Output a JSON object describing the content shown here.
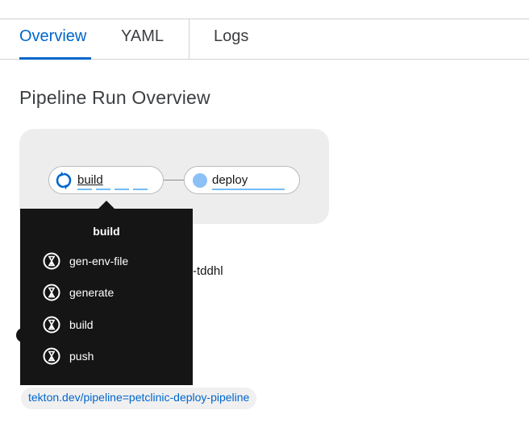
{
  "tabs": [
    {
      "label": "Overview",
      "active": true
    },
    {
      "label": "YAML",
      "active": false
    },
    {
      "label": "Logs",
      "active": false
    }
  ],
  "page_title": "Pipeline Run Overview",
  "topology": {
    "nodes": [
      {
        "label": "build",
        "status": "running"
      },
      {
        "label": "deploy",
        "status": "pending"
      }
    ]
  },
  "tooltip": {
    "title": "build",
    "tasks": [
      {
        "label": "gen-env-file",
        "icon": "hourglass-icon"
      },
      {
        "label": "generate",
        "icon": "hourglass-icon"
      },
      {
        "label": "build",
        "icon": "hourglass-icon"
      },
      {
        "label": "push",
        "icon": "hourglass-icon"
      }
    ]
  },
  "partial_name": "-tddhl",
  "label_chip": "tekton.dev/pipeline=petclinic-deploy-pipeline",
  "colors": {
    "accent": "#0066cc",
    "running": "#0066cc",
    "pending": "#8bc1f7",
    "tooltip_bg": "#151515"
  }
}
